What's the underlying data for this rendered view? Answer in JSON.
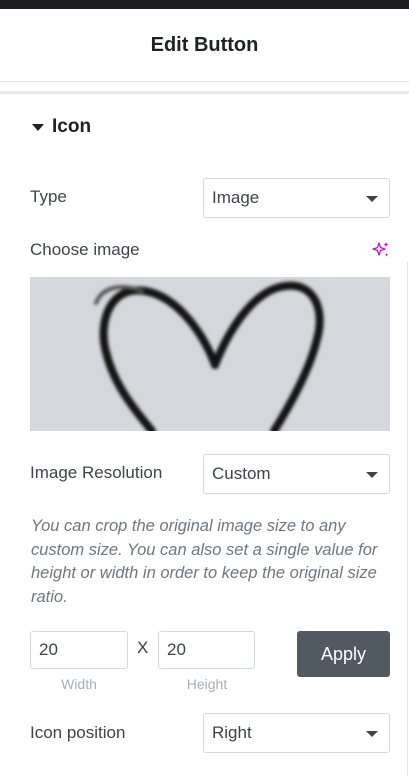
{
  "panel": {
    "title": "Edit Button"
  },
  "section": {
    "title": "Icon"
  },
  "type_field": {
    "label": "Type",
    "value": "Image"
  },
  "image_field": {
    "label": "Choose image"
  },
  "resolution_field": {
    "label": "Image Resolution",
    "value": "Custom"
  },
  "help_text": "You can crop the original image size to any custom size. You can also set a single value for height or width in order to keep the original size ratio.",
  "size": {
    "width_value": "20",
    "height_value": "20",
    "separator": "X",
    "width_label": "Width",
    "height_label": "Height",
    "apply_label": "Apply"
  },
  "position_field": {
    "label": "Icon position",
    "value": "Right"
  },
  "colors": {
    "ai_accent": "#c216c5",
    "apply_bg": "#515962",
    "preview_bg": "#d4d7db"
  },
  "icons": {
    "section_toggle": "caret-down-icon",
    "ai": "sparkle-icon",
    "dropdown": "chevron-down-icon"
  }
}
